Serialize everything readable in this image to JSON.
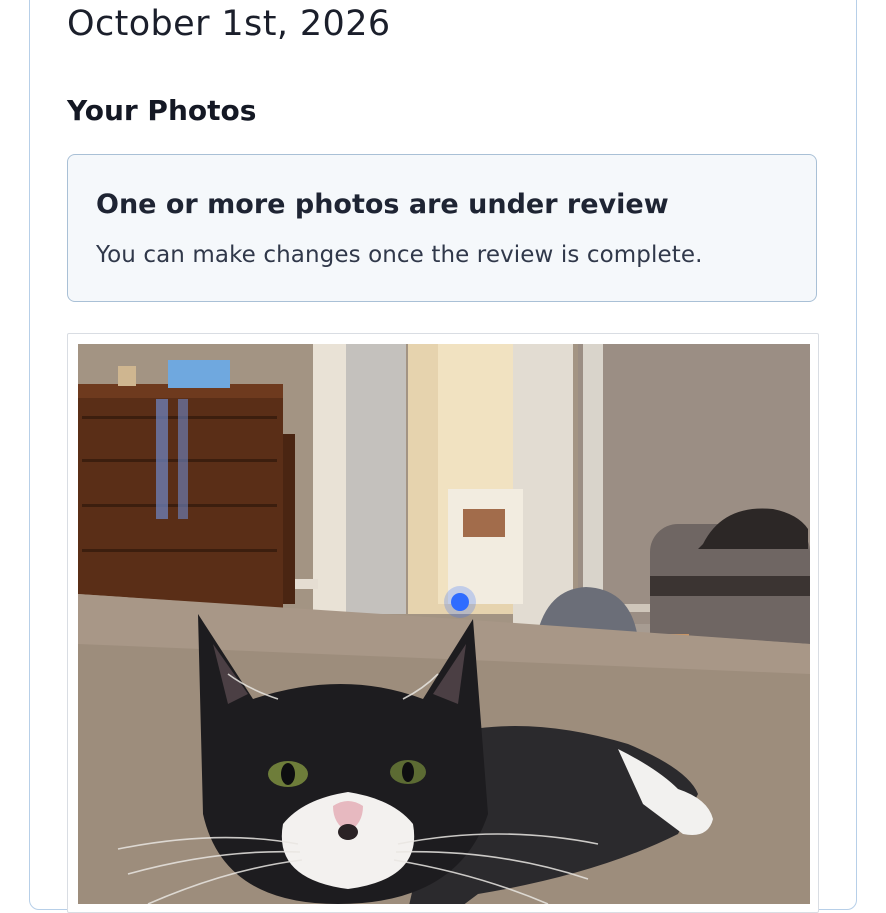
{
  "date": "October 1st, 2026",
  "section_title": "Your Photos",
  "notice": {
    "title": "One or more photos are under review",
    "body": "You can make changes once the review is complete."
  },
  "photo": {
    "subject": "black-and-white-cat-photo"
  }
}
